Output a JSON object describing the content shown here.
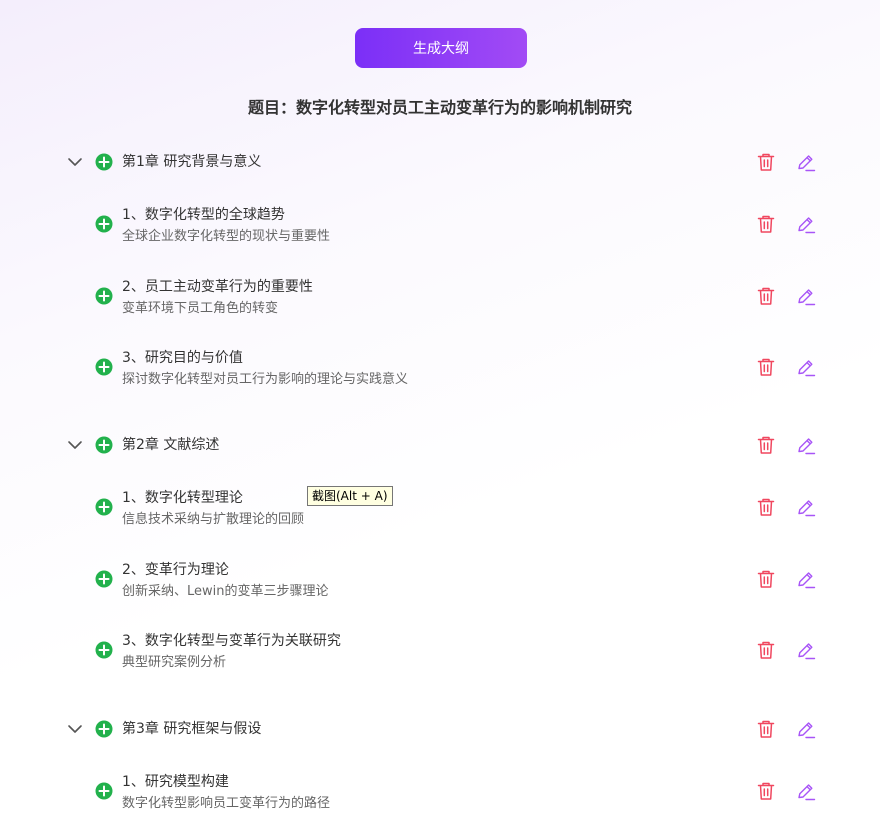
{
  "header": {
    "generate_label": "生成大纲"
  },
  "page_title": "题目：数字化转型对员工主动变革行为的影响机制研究",
  "tooltip": "截图(Alt + A)",
  "chapters": [
    {
      "label": "第1章 研究背景与意义",
      "sections": [
        {
          "title": "1、数字化转型的全球趋势",
          "desc": "全球企业数字化转型的现状与重要性"
        },
        {
          "title": "2、员工主动变革行为的重要性",
          "desc": "变革环境下员工角色的转变"
        },
        {
          "title": "3、研究目的与价值",
          "desc": "探讨数字化转型对员工行为影响的理论与实践意义"
        }
      ]
    },
    {
      "label": "第2章 文献综述",
      "sections": [
        {
          "title": "1、数字化转型理论",
          "desc": "信息技术采纳与扩散理论的回顾"
        },
        {
          "title": "2、变革行为理论",
          "desc": "创新采纳、Lewin的变革三步骤理论"
        },
        {
          "title": "3、数字化转型与变革行为关联研究",
          "desc": "典型研究案例分析"
        }
      ]
    },
    {
      "label": "第3章 研究框架与假设",
      "sections": [
        {
          "title": "1、研究模型构建",
          "desc": "数字化转型影响员工变革行为的路径"
        }
      ]
    }
  ],
  "colors": {
    "accent": "#7b2ff7",
    "add": "#22b14c",
    "delete": "#f0475f",
    "edit": "#a855f7"
  },
  "icons": {
    "collapse": "chevron-down-icon",
    "add": "plus-circle-icon",
    "delete": "trash-icon",
    "edit": "pencil-icon"
  }
}
